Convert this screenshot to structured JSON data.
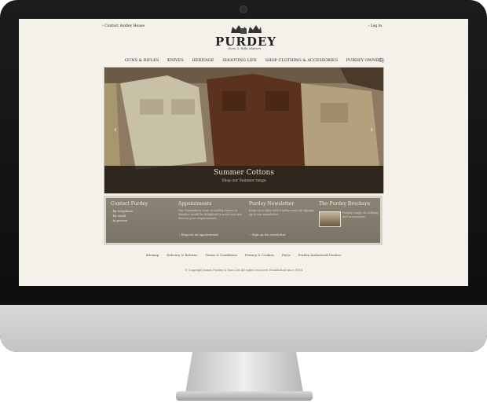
{
  "topbar": {
    "left_link": "› Contact Audley House",
    "right_link": "› Log in"
  },
  "brand": {
    "logo": "PURDEY",
    "tagline": "Guns & Rifle Makers"
  },
  "nav": {
    "items": [
      "GUNS & RIFLES",
      "KNIVES",
      "HERITAGE",
      "SHOOTING LIFE",
      "SHOP CLOTHING & ACCESSORIES",
      "PURDEY OWNERS"
    ]
  },
  "hero": {
    "title": "Summer Cottons",
    "subtitle": "Shop our Summer range",
    "prev": "‹",
    "next": "›"
  },
  "panel": {
    "contact": {
      "title": "Contact Purdey",
      "links": [
        "› By telephone",
        "› By email",
        "› In person"
      ]
    },
    "appointments": {
      "title": "Appointments",
      "text": "Our Gunmakers team at Audley House in Mayfair would be delighted to meet you and discuss your requirements.",
      "link": "› Request an appointment"
    },
    "newsletter": {
      "title": "Purdey Newsletter",
      "text": "Keep up to date with Purdey news by signing up to our newsletter",
      "link": "› Sign up for newsletter"
    },
    "brochure": {
      "title": "The Purdey Brochure",
      "text": "Purdey range of clothing and accessories"
    }
  },
  "footer": {
    "links": [
      "Sitemap",
      "Delivery & Returns",
      "Terms & Conditions",
      "Privacy & Cookies",
      "FAQs",
      "Purdey Authorised Dealers"
    ],
    "copyright": "© Copyright James Purdey & Sons Ltd All rights reserved. Established since 1814"
  }
}
